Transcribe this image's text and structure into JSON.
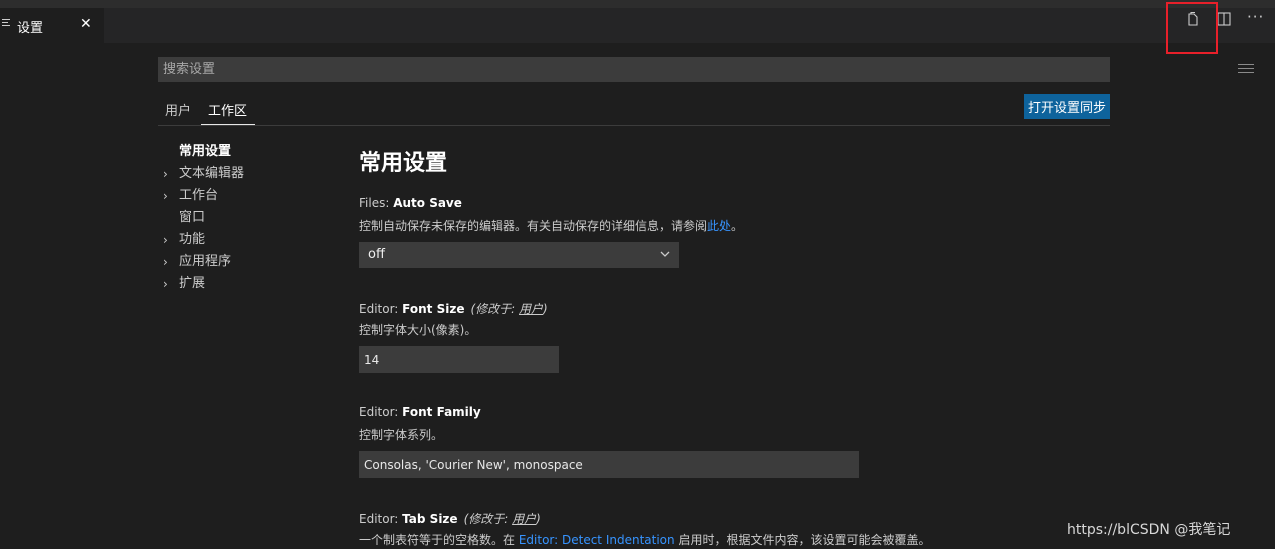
{
  "tab": {
    "label": "设置",
    "close": "✕",
    "icon": "settings-list-icon"
  },
  "actions": {
    "open_json_icon": "open-settings-json-icon",
    "split_icon": "split-editor-icon",
    "more": "···"
  },
  "search": {
    "placeholder": "搜索设置",
    "value": ""
  },
  "scope_tabs": {
    "user": "用户",
    "workspace": "工作区",
    "active": "工作区"
  },
  "sync_button": "打开设置同步",
  "toc": [
    {
      "label": "常用设置",
      "expandable": false,
      "active": true
    },
    {
      "label": "文本编辑器",
      "expandable": true
    },
    {
      "label": "工作台",
      "expandable": true
    },
    {
      "label": "窗口",
      "expandable": false
    },
    {
      "label": "功能",
      "expandable": true
    },
    {
      "label": "应用程序",
      "expandable": true
    },
    {
      "label": "扩展",
      "expandable": true
    }
  ],
  "section_title": "常用设置",
  "settings": {
    "auto_save": {
      "category": "Files: ",
      "name": "Auto Save",
      "desc_before": "控制自动保存未保存的编辑器。有关自动保存的详细信息，请参阅",
      "desc_link": "此处",
      "desc_after": "。",
      "value": "off"
    },
    "font_size": {
      "category": "Editor: ",
      "name": "Font Size",
      "modified_prefix": "(修改于: ",
      "modified_link": "用户",
      "modified_suffix": ")",
      "desc": "控制字体大小(像素)。",
      "value": "14"
    },
    "font_family": {
      "category": "Editor: ",
      "name": "Font Family",
      "desc": "控制字体系列。",
      "value": "Consolas, 'Courier New', monospace"
    },
    "tab_size": {
      "category": "Editor: ",
      "name": "Tab Size",
      "modified_prefix": "(修改于: ",
      "modified_link": "用户",
      "modified_suffix": ")",
      "desc_before": "一个制表符等于的空格数。在 ",
      "desc_link": "Editor: Detect Indentation",
      "desc_after": " 启用时，根据文件内容，该设置可能会被覆盖。"
    }
  },
  "watermark": "https://blCSDN @我笔记",
  "colors": {
    "accent_button": "#0e639c",
    "link": "#3794ff",
    "highlight_box": "#e8202a"
  }
}
